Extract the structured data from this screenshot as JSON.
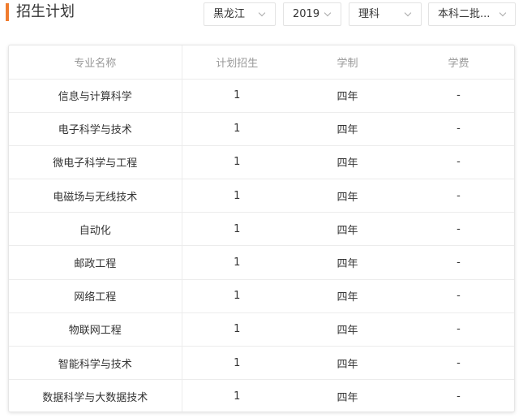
{
  "section": {
    "title": "招生计划"
  },
  "filters": {
    "province": "黑龙江",
    "year": "2019",
    "subject": "理科",
    "batch": "本科二批..."
  },
  "table": {
    "headers": [
      "专业名称",
      "计划招生",
      "学制",
      "学费"
    ],
    "rows": [
      {
        "major": "信息与计算科学",
        "plan": "1",
        "duration": "四年",
        "fee": "-"
      },
      {
        "major": "电子科学与技术",
        "plan": "1",
        "duration": "四年",
        "fee": "-"
      },
      {
        "major": "微电子科学与工程",
        "plan": "1",
        "duration": "四年",
        "fee": "-"
      },
      {
        "major": "电磁场与无线技术",
        "plan": "1",
        "duration": "四年",
        "fee": "-"
      },
      {
        "major": "自动化",
        "plan": "1",
        "duration": "四年",
        "fee": "-"
      },
      {
        "major": "邮政工程",
        "plan": "1",
        "duration": "四年",
        "fee": "-"
      },
      {
        "major": "网络工程",
        "plan": "1",
        "duration": "四年",
        "fee": "-"
      },
      {
        "major": "物联网工程",
        "plan": "1",
        "duration": "四年",
        "fee": "-"
      },
      {
        "major": "智能科学与技术",
        "plan": "1",
        "duration": "四年",
        "fee": "-"
      },
      {
        "major": "数据科学与大数据技术",
        "plan": "1",
        "duration": "四年",
        "fee": "-"
      }
    ]
  },
  "colors": {
    "accent": "#f07c2f",
    "header_text": "#999999",
    "body_text": "#333333",
    "border": "#ececec"
  },
  "icons": {
    "dropdown": "chevron-down-icon"
  }
}
